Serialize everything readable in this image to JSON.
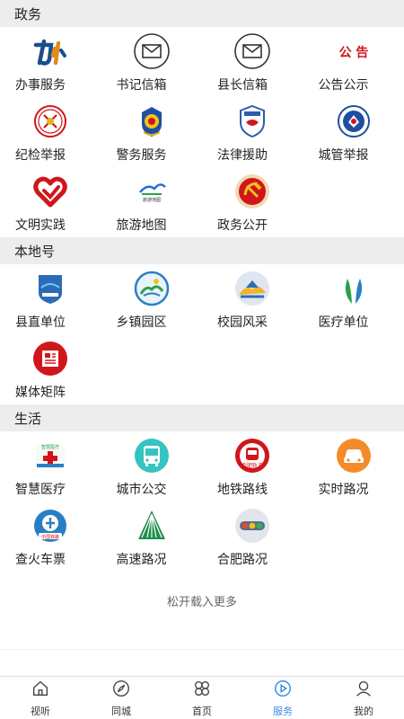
{
  "sections": [
    {
      "title": "政务",
      "items": [
        {
          "label": "办事服务",
          "icon": "banshi-logo-icon"
        },
        {
          "label": "书记信箱",
          "icon": "mail-icon"
        },
        {
          "label": "县长信箱",
          "icon": "mail-icon"
        },
        {
          "label": "公告公示",
          "icon": "gonggao-text-icon",
          "icon_text": "公 告"
        },
        {
          "label": "纪检举报",
          "icon": "jijian-emblem-icon"
        },
        {
          "label": "警务服务",
          "icon": "police-badge-icon"
        },
        {
          "label": "法律援助",
          "icon": "legal-aid-icon"
        },
        {
          "label": "城管举报",
          "icon": "chengguan-badge-icon"
        },
        {
          "label": "文明实践",
          "icon": "heart-icon"
        },
        {
          "label": "旅游地图",
          "icon": "tourism-logo-icon"
        },
        {
          "label": "政务公开",
          "icon": "hammer-sickle-icon"
        }
      ]
    },
    {
      "title": "本地号",
      "items": [
        {
          "label": "县直单位",
          "icon": "county-shield-icon"
        },
        {
          "label": "乡镇园区",
          "icon": "town-park-icon"
        },
        {
          "label": "校园风采",
          "icon": "campus-icon"
        },
        {
          "label": "医疗单位",
          "icon": "medical-leaf-icon"
        },
        {
          "label": "媒体矩阵",
          "icon": "newspaper-icon"
        }
      ]
    },
    {
      "title": "生活",
      "items": [
        {
          "label": "智慧医疗",
          "icon": "smart-medical-icon"
        },
        {
          "label": "城市公交",
          "icon": "bus-icon"
        },
        {
          "label": "地铁路线",
          "icon": "metro-icon"
        },
        {
          "label": "实时路况",
          "icon": "car-icon"
        },
        {
          "label": "查火车票",
          "icon": "railway-icon"
        },
        {
          "label": "高速路况",
          "icon": "highway-icon"
        },
        {
          "label": "合肥路况",
          "icon": "traffic-light-icon"
        }
      ]
    }
  ],
  "load_more": "松开载入更多",
  "tabs": [
    {
      "label": "视听",
      "icon": "house-icon",
      "active": false
    },
    {
      "label": "同城",
      "icon": "compass-icon",
      "active": false
    },
    {
      "label": "首页",
      "icon": "clover-icon",
      "active": false
    },
    {
      "label": "服务",
      "icon": "play-circle-icon",
      "active": true
    },
    {
      "label": "我的",
      "icon": "user-icon",
      "active": false
    }
  ],
  "colors": {
    "accent": "#3a8be8",
    "section_bg": "#ededed"
  }
}
